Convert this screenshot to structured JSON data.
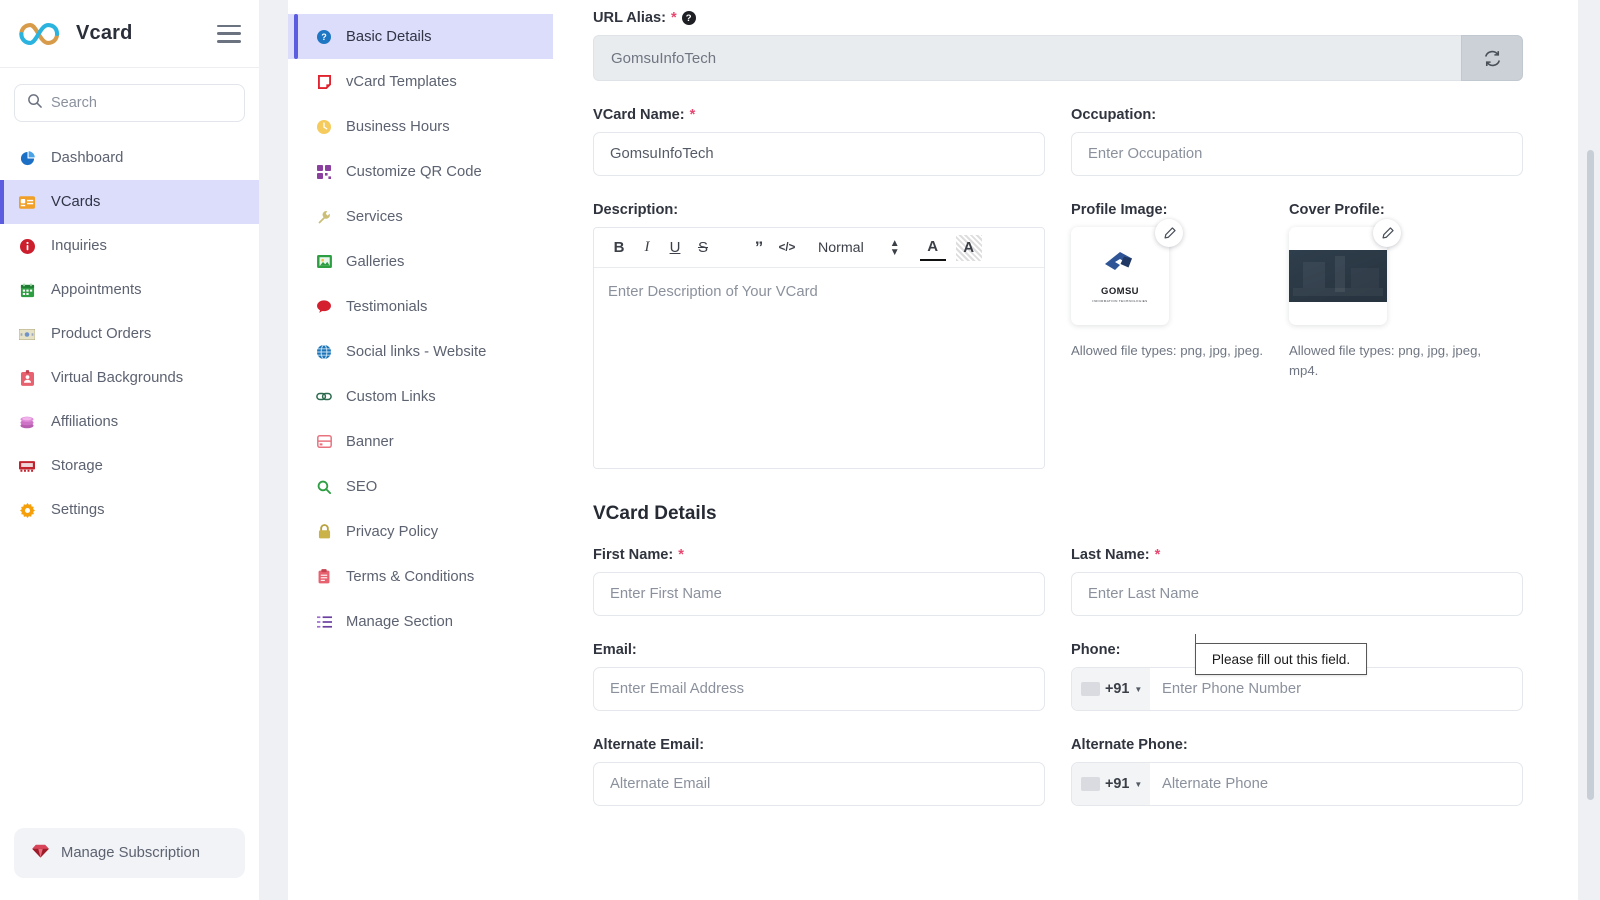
{
  "brand": {
    "name": "Vcard",
    "logo_icon": "infinity-logo",
    "menu_icon": "hamburger-icon"
  },
  "search": {
    "placeholder": "Search",
    "icon": "search-icon"
  },
  "sidebar": {
    "items": [
      {
        "label": "Dashboard",
        "icon": "pie-chart-icon",
        "emoji": "📊",
        "active": false
      },
      {
        "label": "VCards",
        "icon": "id-card-icon",
        "emoji": "🪪",
        "active": true
      },
      {
        "label": "Inquiries",
        "icon": "info-circle-icon",
        "emoji": "ℹ️",
        "active": false
      },
      {
        "label": "Appointments",
        "icon": "calendar-icon",
        "emoji": "📅",
        "active": false
      },
      {
        "label": "Product Orders",
        "icon": "money-icon",
        "emoji": "💵",
        "active": false
      },
      {
        "label": "Virtual Backgrounds",
        "icon": "badge-icon",
        "emoji": "📛",
        "active": false
      },
      {
        "label": "Affiliations",
        "icon": "coins-icon",
        "emoji": "🎨",
        "active": false
      },
      {
        "label": "Storage",
        "icon": "storage-icon",
        "emoji": "🗄",
        "active": false
      },
      {
        "label": "Settings",
        "icon": "gear-icon",
        "emoji": "⚙️",
        "active": false
      }
    ],
    "subscription": {
      "label": "Manage Subscription",
      "icon": "gem-icon",
      "emoji": "💎"
    }
  },
  "section_nav": {
    "items": [
      {
        "label": "Basic Details",
        "icon": "question-circle-icon",
        "emoji": "❓",
        "active": true
      },
      {
        "label": "vCard Templates",
        "icon": "template-icon",
        "emoji": "🔖",
        "active": false
      },
      {
        "label": "Business Hours",
        "icon": "clock-icon",
        "emoji": "🕐",
        "active": false
      },
      {
        "label": "Customize QR Code",
        "icon": "qr-code-icon",
        "emoji": "🔳",
        "active": false
      },
      {
        "label": "Services",
        "icon": "wrench-icon",
        "emoji": "🔧",
        "active": false
      },
      {
        "label": "Galleries",
        "icon": "image-icon",
        "emoji": "🖼",
        "active": false
      },
      {
        "label": "Testimonials",
        "icon": "speech-bubble-icon",
        "emoji": "💬",
        "active": false
      },
      {
        "label": "Social links - Website",
        "icon": "globe-icon",
        "emoji": "🌐",
        "active": false
      },
      {
        "label": "Custom Links",
        "icon": "link-icon",
        "emoji": "🔗",
        "active": false
      },
      {
        "label": "Banner",
        "icon": "banner-icon",
        "emoji": "🪧",
        "active": false
      },
      {
        "label": "SEO",
        "icon": "magnifier-icon",
        "emoji": "🔍",
        "active": false
      },
      {
        "label": "Privacy Policy",
        "icon": "lock-icon",
        "emoji": "🔒",
        "active": false
      },
      {
        "label": "Terms & Conditions",
        "icon": "clipboard-icon",
        "emoji": "📋",
        "active": false
      },
      {
        "label": "Manage Section",
        "icon": "list-icon",
        "emoji": "📑",
        "active": false
      }
    ]
  },
  "form": {
    "url_alias": {
      "label": "URL Alias:",
      "required_mark": "*",
      "help_icon": "question-mark-icon",
      "help_glyph": "?",
      "value": "GomsuInfoTech",
      "refresh_icon": "refresh-icon"
    },
    "vcard_name": {
      "label": "VCard Name:",
      "required_mark": "*",
      "value": "GomsuInfoTech"
    },
    "occupation": {
      "label": "Occupation:",
      "placeholder": "Enter Occupation",
      "value": ""
    },
    "description": {
      "label": "Description:",
      "placeholder": "Enter Description of Your VCard",
      "value": "",
      "toolbar": [
        {
          "name": "bold-button",
          "glyph": "B"
        },
        {
          "name": "italic-button",
          "glyph": "I"
        },
        {
          "name": "underline-button",
          "glyph": "U"
        },
        {
          "name": "strikethrough-button",
          "glyph": "S"
        },
        {
          "name": "blockquote-button",
          "glyph": "”"
        },
        {
          "name": "code-block-button",
          "glyph": "</>"
        }
      ],
      "format_select": "Normal",
      "color_button": "A",
      "highlight_button": "A"
    },
    "profile_image": {
      "label": "Profile Image:",
      "edit_icon": "pencil-icon",
      "allowed": "Allowed file types: png, jpg, jpeg.",
      "thumb_alt": "GOMSU",
      "thumb_sub": "INFORMATION TECHNOLOGIES"
    },
    "cover_profile": {
      "label": "Cover Profile:",
      "edit_icon": "pencil-icon",
      "allowed": "Allowed file types: png, jpg, jpeg, mp4."
    },
    "details_title": "VCard Details",
    "first_name": {
      "label": "First Name:",
      "required_mark": "*",
      "placeholder": "Enter First Name",
      "value": ""
    },
    "last_name": {
      "label": "Last Name:",
      "required_mark": "*",
      "placeholder": "Enter Last Name",
      "value": ""
    },
    "email": {
      "label": "Email:",
      "placeholder": "Enter Email Address",
      "value": ""
    },
    "phone": {
      "label": "Phone:",
      "placeholder": "Enter Phone Number",
      "country_code": "+91",
      "value": ""
    },
    "alt_email": {
      "label": "Alternate Email:",
      "placeholder": "Alternate Email",
      "value": ""
    },
    "alt_phone": {
      "label": "Alternate Phone:",
      "placeholder": "Alternate Phone",
      "country_code": "+91",
      "value": ""
    }
  },
  "tooltip": {
    "text": "Please fill out this field."
  },
  "colors": {
    "accent": "#5c5ce0",
    "active_bg": "#dcdcfb",
    "required": "#e8476f",
    "page_bg": "#eef0f4"
  }
}
